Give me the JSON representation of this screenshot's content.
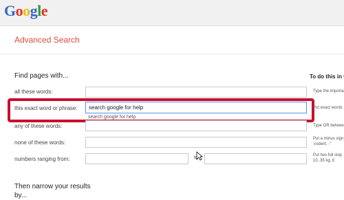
{
  "logo": {
    "letters": [
      {
        "ch": "G",
        "color": "#3366cc"
      },
      {
        "ch": "o",
        "color": "#dd3322"
      },
      {
        "ch": "o",
        "color": "#eebb00"
      },
      {
        "ch": "g",
        "color": "#3366cc"
      },
      {
        "ch": "l",
        "color": "#339933"
      },
      {
        "ch": "e",
        "color": "#dd3322"
      }
    ]
  },
  "page": {
    "title": "Advanced Search",
    "section_title": "Find pages with...",
    "help_header": "To do this in th",
    "narrow_title_line1": "Then narrow your results",
    "narrow_title_line2": "by..."
  },
  "rows": {
    "all_words": {
      "label": "all these words:",
      "value": "",
      "hint": "Type the importa"
    },
    "exact_phrase": {
      "label": "this exact word or phrase:",
      "value": "search google for help",
      "hint": "Put exact words"
    },
    "autocomplete": {
      "suggestion": "search google for help"
    },
    "any_words": {
      "label": "any of these words:",
      "value": "",
      "hint": "Type OR betwee"
    },
    "none_words": {
      "label": "none of these words:",
      "value": "",
      "hint_line1": "Put a minus sign",
      "hint_line2": "-rodent, -\""
    },
    "numbers": {
      "label": "numbers ranging from:",
      "to_label": "to",
      "hint_line1": "Put two full stop",
      "hint_line2": "10..35 kg, £"
    }
  },
  "colors": {
    "accent_red": "#dd4b39",
    "highlight_border": "#c8102e",
    "focus_border": "#4d90fe"
  }
}
